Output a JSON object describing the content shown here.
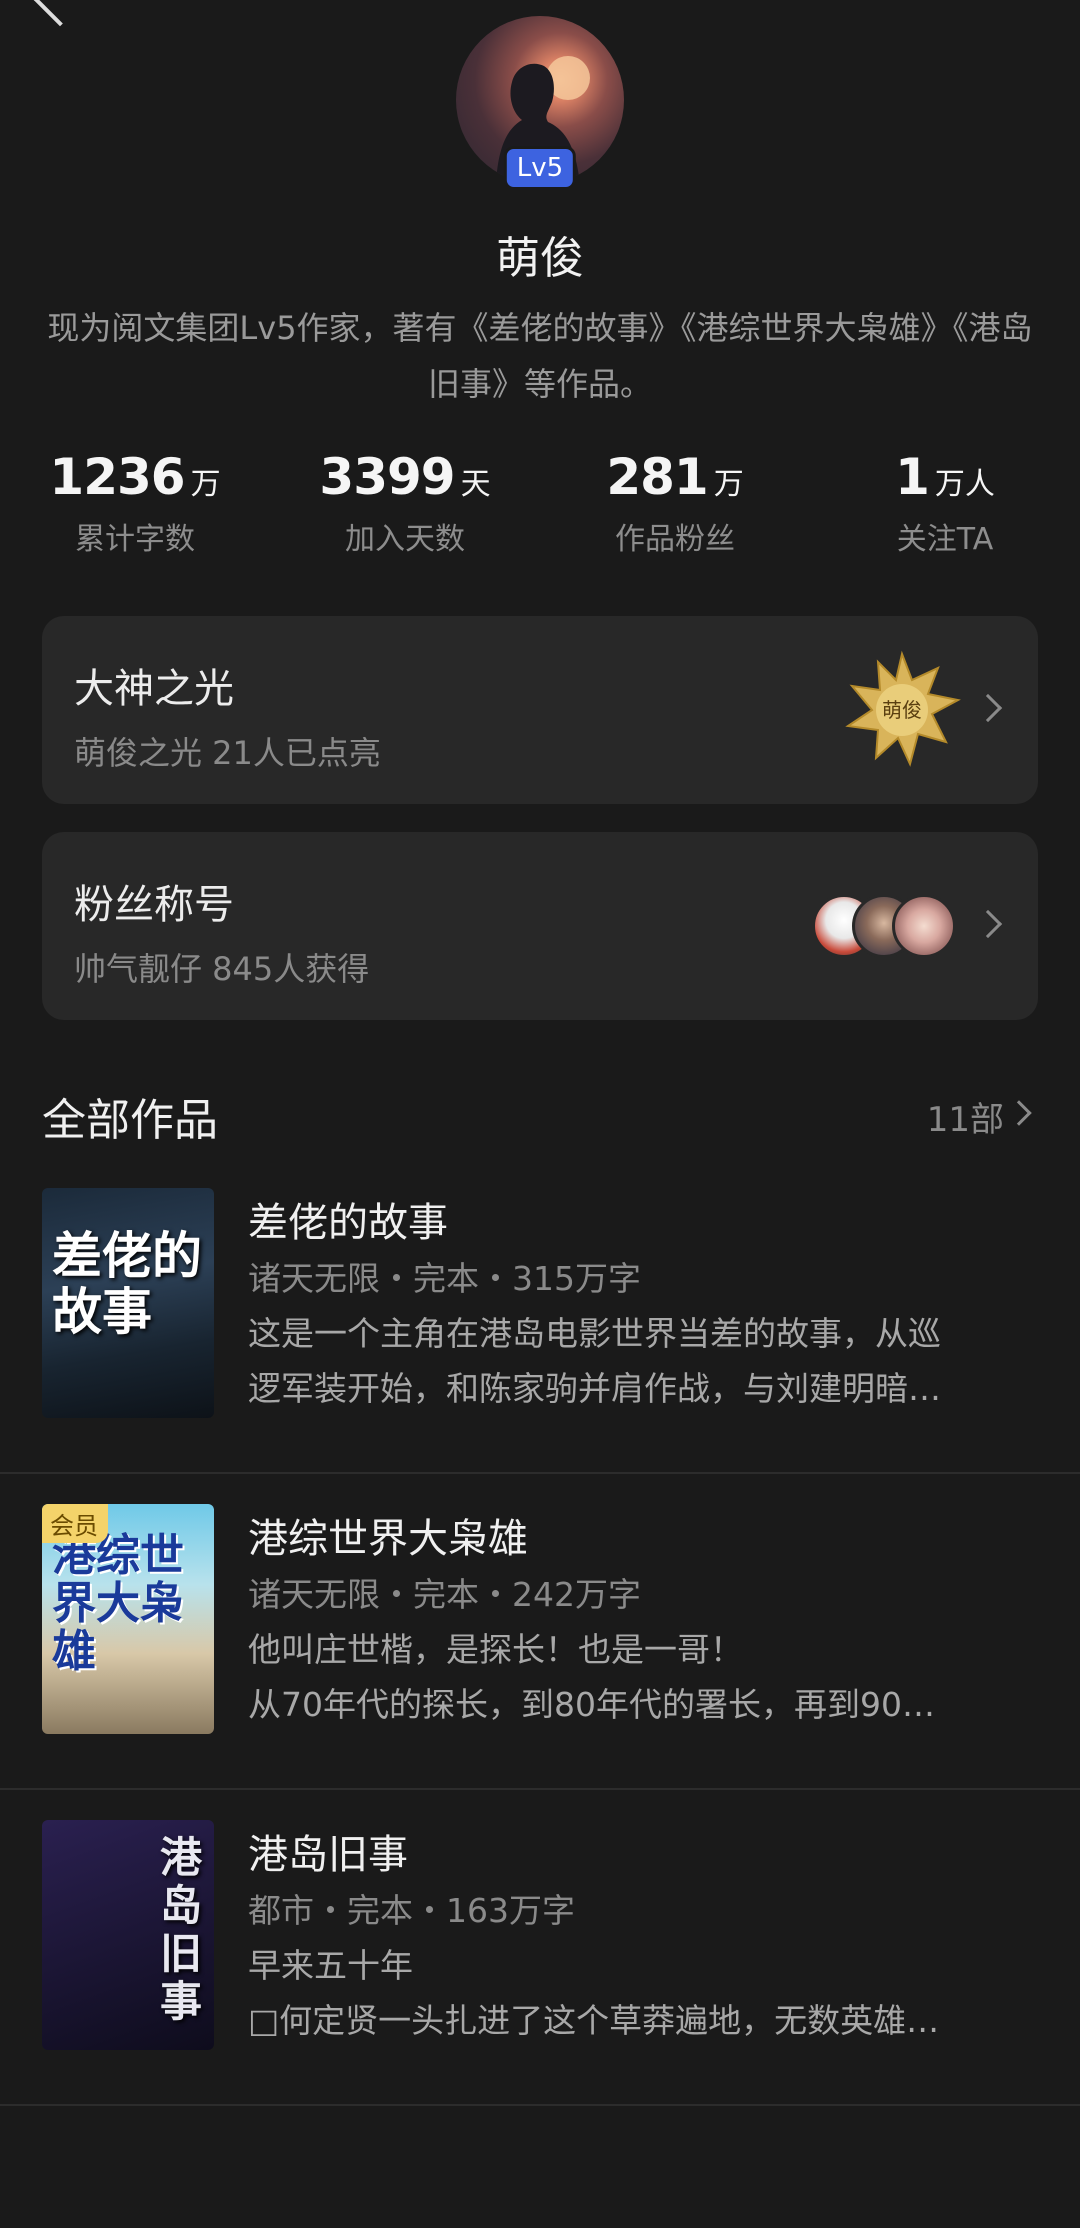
{
  "profile": {
    "level": "Lv5",
    "name": "萌俊",
    "bio": "现为阅文集团Lv5作家，著有《差佬的故事》《港综世界大枭雄》《港岛旧事》等作品。"
  },
  "stats": [
    {
      "value": "1236",
      "unit": "万",
      "label": "累计字数"
    },
    {
      "value": "3399",
      "unit": "天",
      "label": "加入天数"
    },
    {
      "value": "281",
      "unit": "万",
      "label": "作品粉丝"
    },
    {
      "value": "1",
      "unit": "万人",
      "label": "关注TA"
    }
  ],
  "cards": {
    "light": {
      "title": "大神之光",
      "subtitle": "萌俊之光 21人已点亮",
      "medal_text": "萌俊"
    },
    "fan_title": {
      "title": "粉丝称号",
      "subtitle": "帅气靓仔 845人获得"
    }
  },
  "works": {
    "title": "全部作品",
    "count": "11部",
    "books": [
      {
        "title": "差佬的故事",
        "meta": "诸天无限・完本・315万字",
        "desc1": "这是一个主角在港岛电影世界当差的故事，从巡",
        "desc2": "逻军装开始，和陈家驹并肩作战，与刘建明暗…",
        "cover_text": "差佬的故事"
      },
      {
        "title": "港综世界大枭雄",
        "meta": "诸天无限・完本・242万字",
        "desc1": "他叫庄世楷，是探长！也是一哥！",
        "desc2": "从70年代的探长，到80年代的署长，再到90…",
        "cover_text": "港综世界大枭雄",
        "vip": "会员"
      },
      {
        "title": "港岛旧事",
        "meta": "都市・完本・163万字",
        "desc1": "早来五十年",
        "desc2": "□何定贤一头扎进了这个草莽遍地，无数英雄…",
        "cover_text": "港岛旧事"
      }
    ]
  }
}
